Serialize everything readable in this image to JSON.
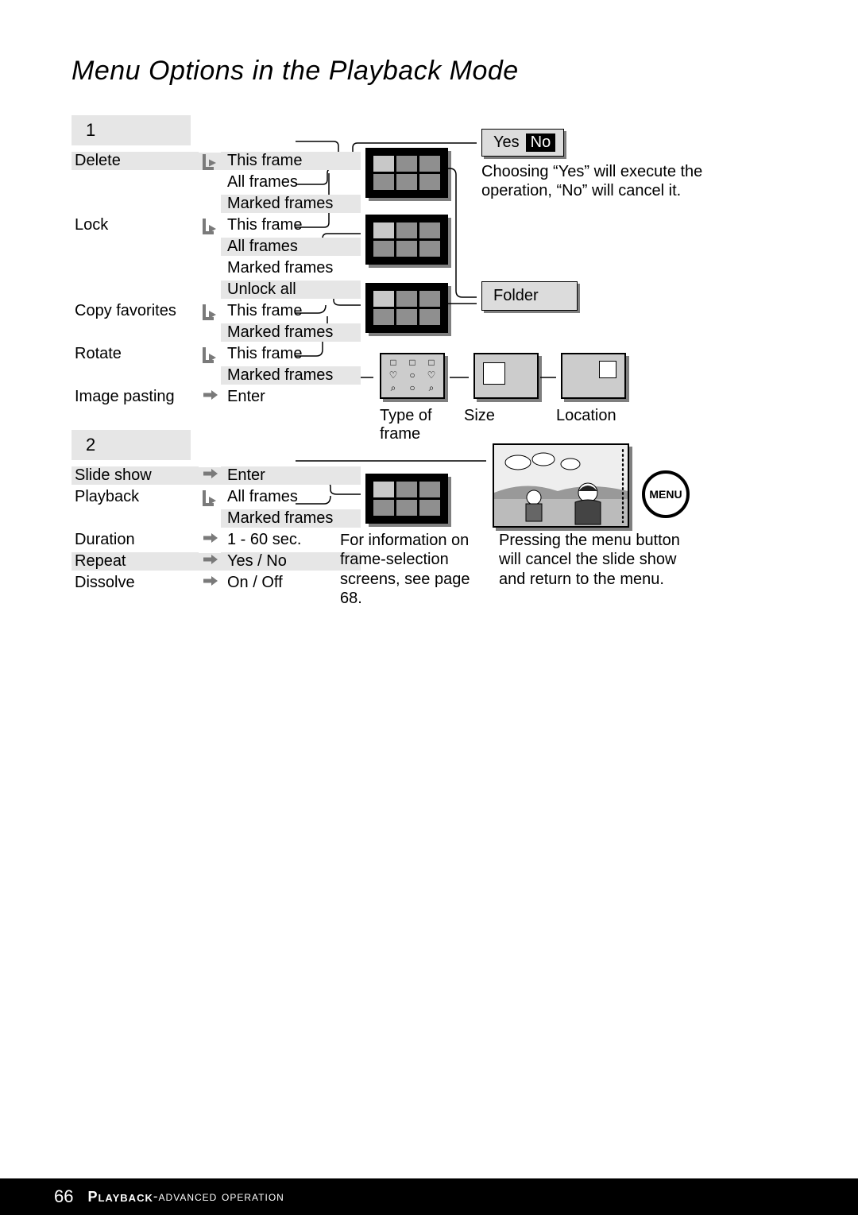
{
  "title": "Menu Options in the Playback Mode",
  "sections": {
    "one": {
      "badge": "1"
    },
    "two": {
      "badge": "2"
    }
  },
  "menu1": {
    "r0": {
      "left": "Delete",
      "right": "This frame"
    },
    "r1": {
      "right": "All frames"
    },
    "r2": {
      "right": "Marked frames"
    },
    "r3": {
      "left": "Lock",
      "right": "This frame"
    },
    "r4": {
      "right": "All frames"
    },
    "r5": {
      "right": "Marked frames"
    },
    "r6": {
      "right": "Unlock all"
    },
    "r7": {
      "left": "Copy favorites",
      "right": "This frame"
    },
    "r8": {
      "right": "Marked frames"
    },
    "r9": {
      "left": "Rotate",
      "right": "This frame"
    },
    "r10": {
      "right": "Marked frames"
    },
    "r11": {
      "left": "Image pasting",
      "right": "Enter"
    }
  },
  "menu2": {
    "r0": {
      "left": "Slide show",
      "right": "Enter"
    },
    "r1": {
      "left": "Playback",
      "right": "All frames"
    },
    "r2": {
      "right": "Marked frames"
    },
    "r3": {
      "left": "Duration",
      "right": "1 - 60 sec."
    },
    "r4": {
      "left": "Repeat",
      "right": "Yes / No"
    },
    "r5": {
      "left": "Dissolve",
      "right": "On / Off"
    }
  },
  "yesno": {
    "yes": "Yes",
    "no": "No"
  },
  "yesno_caption": "Choosing “Yes” will execute the operation, “No” will cancel it.",
  "folder_label": "Folder",
  "labels": {
    "type_of_frame": "Type of frame",
    "size": "Size",
    "location": "Location"
  },
  "info_text": "For information on frame-selection screens, see page 68.",
  "menu_caption": "Pressing the menu button will cancel the slide show and return to the menu.",
  "menu_btn": "MENU",
  "footer": {
    "page": "66",
    "section1": "Playback",
    "sep": " - ",
    "section2": "advanced operation"
  }
}
